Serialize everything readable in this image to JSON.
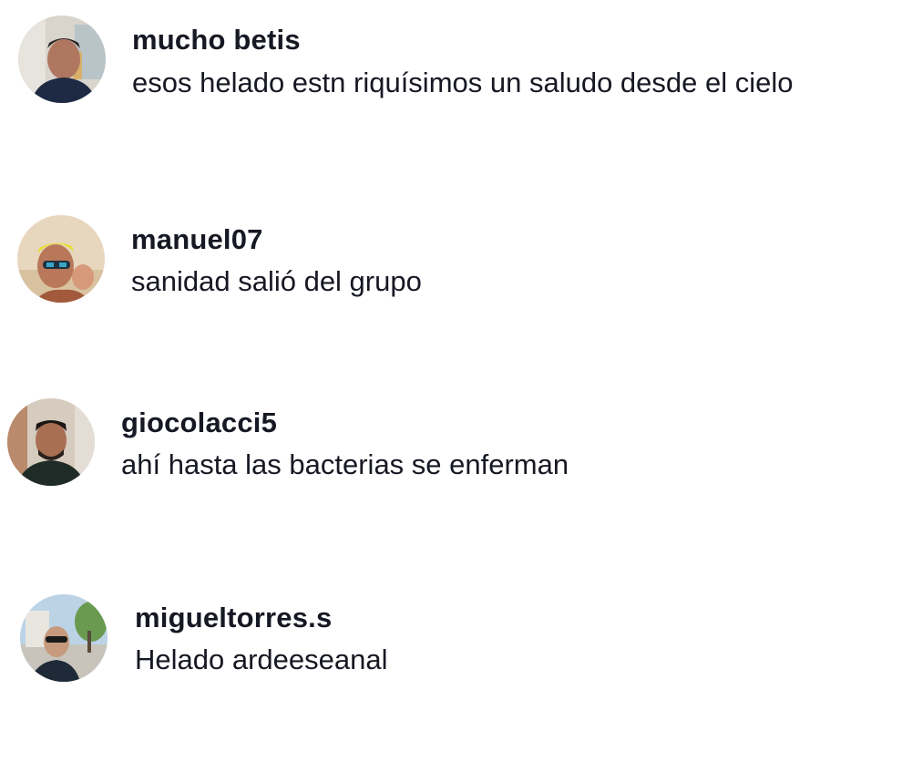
{
  "comments": [
    {
      "username": "mucho betis",
      "text": "esos helado estn riquísimos un saludo desde el cielo",
      "avatar_icon": "user-avatar-man-dark-shirt"
    },
    {
      "username": "manuel07",
      "text": "sanidad salió del grupo",
      "avatar_icon": "user-avatar-beach-sunglasses"
    },
    {
      "username": "giocolacci5",
      "text": "ahí hasta las bacterias se enferman",
      "avatar_icon": "user-avatar-man-beard"
    },
    {
      "username": "migueltorres.s",
      "text": "Helado ardeeseanal",
      "avatar_icon": "user-avatar-selfie-street"
    }
  ],
  "colors": {
    "text": "#161823",
    "background": "#ffffff"
  }
}
